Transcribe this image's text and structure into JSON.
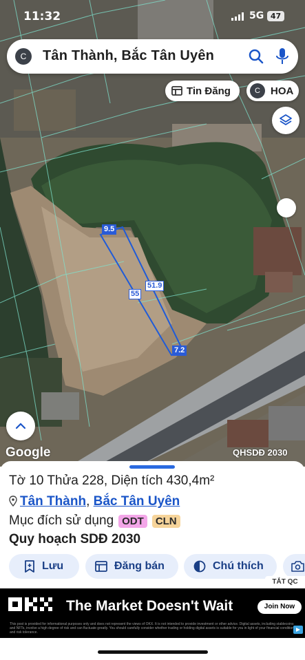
{
  "status_bar": {
    "time": "11:32",
    "network": "5G",
    "battery": "47"
  },
  "search": {
    "avatar_letter": "C",
    "query": "Tân Thành, Bắc Tân Uyên"
  },
  "chips": {
    "post_label": "Tin Đăng",
    "profile_letter": "C",
    "profile_label": "HOA"
  },
  "map": {
    "attribution": "Google",
    "scale_label": "QHSDĐ 2030",
    "dimensions": {
      "top": "9.5",
      "long_side": "51.9",
      "left_side": "55",
      "bottom": "7.2"
    }
  },
  "parcel": {
    "title": "Tờ 10 Thửa 228, Diện tích 430,4m²",
    "ward": "Tân Thành",
    "separator": ", ",
    "district": "Bắc Tân Uyên",
    "purpose_label": "Mục đích sử dụng",
    "purpose_tags": [
      "ODT",
      "CLN"
    ],
    "planning": "Quy hoạch SDĐ 2030"
  },
  "actions": {
    "save": "Lưu",
    "sell": "Đăng bán",
    "legend": "Chú thích"
  },
  "ad": {
    "close_label": "TẮT QC",
    "brand": "OKX",
    "headline": "The Market Doesn't Wait",
    "cta": "Join Now",
    "disclaimer": "This post is provided for informational purposes only and does not represent the views of OKX. It is not intended to provide investment or other advice. Digital assets, including stablecoins and NFTs, involve a high degree of risk and can fluctuate greatly. You should carefully consider whether trading or holding digital assets is suitable for you in light of your financial condition and risk tolerance."
  },
  "colors": {
    "accent": "#2a5bd7",
    "sheet_button_bg": "#e7eefb",
    "tag_odt": "#f3a6e8",
    "tag_cln": "#f6d49a"
  }
}
